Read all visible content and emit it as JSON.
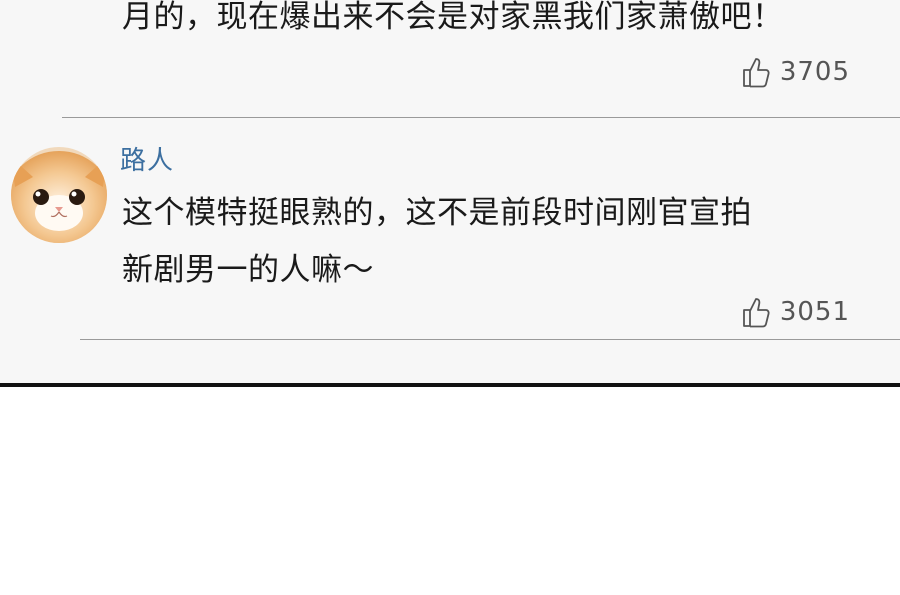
{
  "comments": [
    {
      "lines": [
        "月的，现在爆出来不会是对家黑我们家萧傲吧！"
      ],
      "likes": "3705"
    },
    {
      "username": "路人",
      "lines": [
        "这个模特挺眼熟的，这不是前段时间刚官宣拍",
        "新剧男一的人嘛～"
      ],
      "likes": "3051"
    }
  ],
  "colors": {
    "username": "#3c6fa0",
    "panel_bg": "#f7f7f7",
    "text": "#1a1a1a",
    "like": "#555555"
  },
  "icons": {
    "like": "thumbs-up-icon",
    "avatar": "cat-avatar"
  }
}
